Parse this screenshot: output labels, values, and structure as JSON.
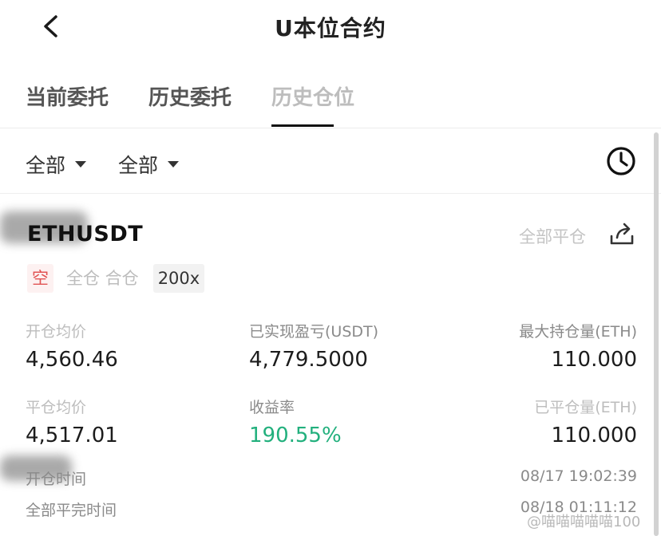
{
  "header": {
    "title": "U本位合约"
  },
  "tabs": [
    {
      "label": "当前委托"
    },
    {
      "label": "历史委托"
    },
    {
      "label": "历史仓位"
    }
  ],
  "filters": {
    "filter1": "全部",
    "filter2": "全部"
  },
  "position": {
    "pair": "ETHUSDT",
    "close_all": "全部平仓",
    "side_tag": "空",
    "margin_tag": "全仓 合仓",
    "leverage_tag": "200x",
    "open_price_label": "开仓均价",
    "open_price": "4,560.46",
    "realized_pnl_label": "已实现盈亏(USDT)",
    "realized_pnl": "4,779.5000",
    "max_position_label": "最大持仓量(ETH)",
    "max_position": "110.000",
    "close_price_label": "平仓均价",
    "close_price": "4,517.01",
    "roi_label": "收益率",
    "roi": "190.55%",
    "closed_qty_label": "已平仓量(ETH)",
    "closed_qty": "110.000",
    "open_time_label": "开仓时间",
    "open_time": "08/17 19:02:39",
    "close_time_label": "全部平完时间",
    "close_time": "08/18 01:11:12"
  },
  "watermark": "@喵喵喵喵喵100",
  "colors": {
    "profit": "#22b07d",
    "short": "#e15353"
  },
  "icons": {
    "back": "chevron-left-icon",
    "history": "clock-icon",
    "share": "share-icon",
    "dropdown": "caret-down-icon"
  }
}
